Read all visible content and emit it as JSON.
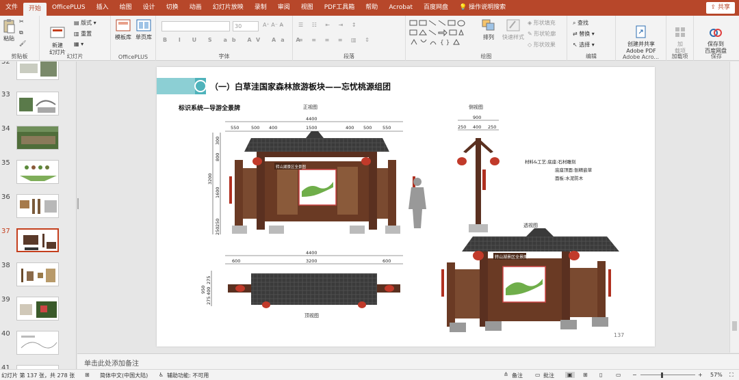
{
  "tabs": [
    "文件",
    "开始",
    "OfficePLUS",
    "插入",
    "绘图",
    "设计",
    "切换",
    "动画",
    "幻灯片放映",
    "录制",
    "审阅",
    "视图",
    "PDF工具箱",
    "帮助",
    "Acrobat",
    "百度网盘"
  ],
  "tell_me": "操作说明搜索",
  "share_label": "共享",
  "ribbon": {
    "clipboard": {
      "paste": "粘贴",
      "group": "剪贴板"
    },
    "slides": {
      "new_slide": "新建\n幻灯片",
      "layout": "版式",
      "reset": "重置",
      "group": "幻灯片"
    },
    "officeplus": {
      "templates": "模板库",
      "single": "单页库",
      "group": "OfficePLUS"
    },
    "font": {
      "size": "30",
      "group": "字体"
    },
    "paragraph": {
      "group": "段落"
    },
    "drawing": {
      "arrange": "排列",
      "quick_styles": "快速样式",
      "fill": "形状填充",
      "outline": "形状轮廓",
      "effects": "形状效果",
      "group": "绘图"
    },
    "editing": {
      "find": "查找",
      "replace": "替换",
      "select": "选择",
      "group": "编辑"
    },
    "adobe": {
      "create": "创建并共享\nAdobe PDF",
      "group": "Adobe Acro..."
    },
    "addins": {
      "load": "加\n载项",
      "group": "加载项"
    },
    "save": {
      "save_baidu": "保存到\n百度网盘",
      "group": "保存"
    }
  },
  "thumbnails": [
    {
      "num": "32",
      "current": false
    },
    {
      "num": "33",
      "current": false
    },
    {
      "num": "34",
      "current": false
    },
    {
      "num": "35",
      "current": false
    },
    {
      "num": "36",
      "current": false
    },
    {
      "num": "37",
      "current": true
    },
    {
      "num": "38",
      "current": false
    },
    {
      "num": "39",
      "current": false
    },
    {
      "num": "40",
      "current": false
    },
    {
      "num": "41",
      "current": false
    }
  ],
  "slide": {
    "title": "（一）白草洼国家森林旅游板块——忘忧桃源组团",
    "subtitle": "标识系统—导游全景牌",
    "front_view": "正视图",
    "side_view": "侧视图",
    "top_view": "顶视图",
    "perspective_view": "透视图",
    "page_number": "137",
    "sign_text": "转山湖景区全景图",
    "materials": [
      "材料&工艺:底座:石材雕刻",
      "底座顶面:刨精嵌草",
      "面板:水泥防木"
    ],
    "front_dims": {
      "total": "4400",
      "parts": [
        "550",
        "500",
        "400",
        "1500",
        "400",
        "500",
        "550"
      ],
      "height_total": "3200",
      "height_parts": [
        "300",
        "800",
        "1600",
        "250",
        "250"
      ]
    },
    "side_dims": {
      "total": "900",
      "parts": [
        "250",
        "400",
        "250"
      ]
    },
    "top_dims": {
      "total": "4400",
      "parts": [
        "600",
        "3200",
        "600"
      ],
      "depth_total": "950",
      "depth_parts": [
        "275",
        "400",
        "275"
      ]
    }
  },
  "notes_placeholder": "单击此处添加备注",
  "status": {
    "slide_info": "幻灯片 第 137 张，共 278 张",
    "language": "简体中文(中国大陆)",
    "accessibility": "辅助功能: 不可用",
    "notes": "备注",
    "comments": "批注",
    "zoom": "57%"
  }
}
